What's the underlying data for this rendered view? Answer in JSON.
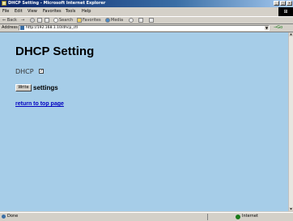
{
  "window": {
    "title": "DHCP Setting - Microsoft Internet Explorer",
    "buttons": [
      "_",
      "□",
      "×"
    ]
  },
  "menu": [
    "File",
    "Edit",
    "View",
    "Favorites",
    "Tools",
    "Help"
  ],
  "toolbar": {
    "back": "⇐ Back",
    "forward": "→",
    "search": "Search",
    "favorites": "Favorites",
    "media": "Media"
  },
  "address": {
    "label": "Address",
    "url": "http://192.168.1.10/dhcp_ctl",
    "go": "Go"
  },
  "page": {
    "title": "DHCP Setting",
    "dhcp_label": "DHCP",
    "dhcp_checked": true,
    "write_button": "Write",
    "settings_label": "settings",
    "top_link": "return to top page"
  },
  "status": {
    "text": "Done",
    "zone": "Internet"
  },
  "colors": {
    "page_background": "#a6cde8",
    "link": "#0000c0",
    "titlebar": "#0a246a"
  },
  "icons": [
    "ie-icon",
    "minimize-icon",
    "maximize-icon",
    "close-icon",
    "windows-logo-icon",
    "back-icon",
    "forward-icon",
    "stop-icon",
    "refresh-icon",
    "home-icon",
    "search-icon",
    "favorites-icon",
    "media-icon",
    "history-icon",
    "mail-icon",
    "print-icon",
    "page-icon",
    "go-icon",
    "internet-zone-icon"
  ]
}
